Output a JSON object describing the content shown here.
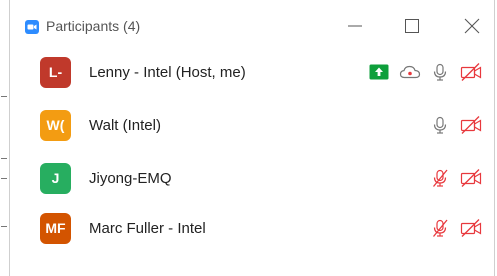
{
  "window": {
    "title": "Participants (4)",
    "icon": "zoom-video-icon"
  },
  "participants": [
    {
      "initials": "L-",
      "name": "Lenny - Intel (Host, me)",
      "avatar_color": "#c0392b",
      "share_screen": true,
      "recording_cloud": true,
      "mic_muted": false,
      "video_off": true
    },
    {
      "initials": "W(",
      "name": "Walt (Intel)",
      "avatar_color": "#f39c12",
      "share_screen": false,
      "recording_cloud": false,
      "mic_muted": false,
      "video_off": true
    },
    {
      "initials": "J",
      "name": "Jiyong-EMQ",
      "avatar_color": "#27ae60",
      "share_screen": false,
      "recording_cloud": false,
      "mic_muted": true,
      "video_off": true
    },
    {
      "initials": "MF",
      "name": "Marc Fuller - Intel",
      "avatar_color": "#d35400",
      "share_screen": false,
      "recording_cloud": false,
      "mic_muted": true,
      "video_off": true
    }
  ],
  "colors": {
    "muted_red": "#e8383d",
    "icon_gray": "#777777",
    "share_green": "#0e9f3b"
  }
}
